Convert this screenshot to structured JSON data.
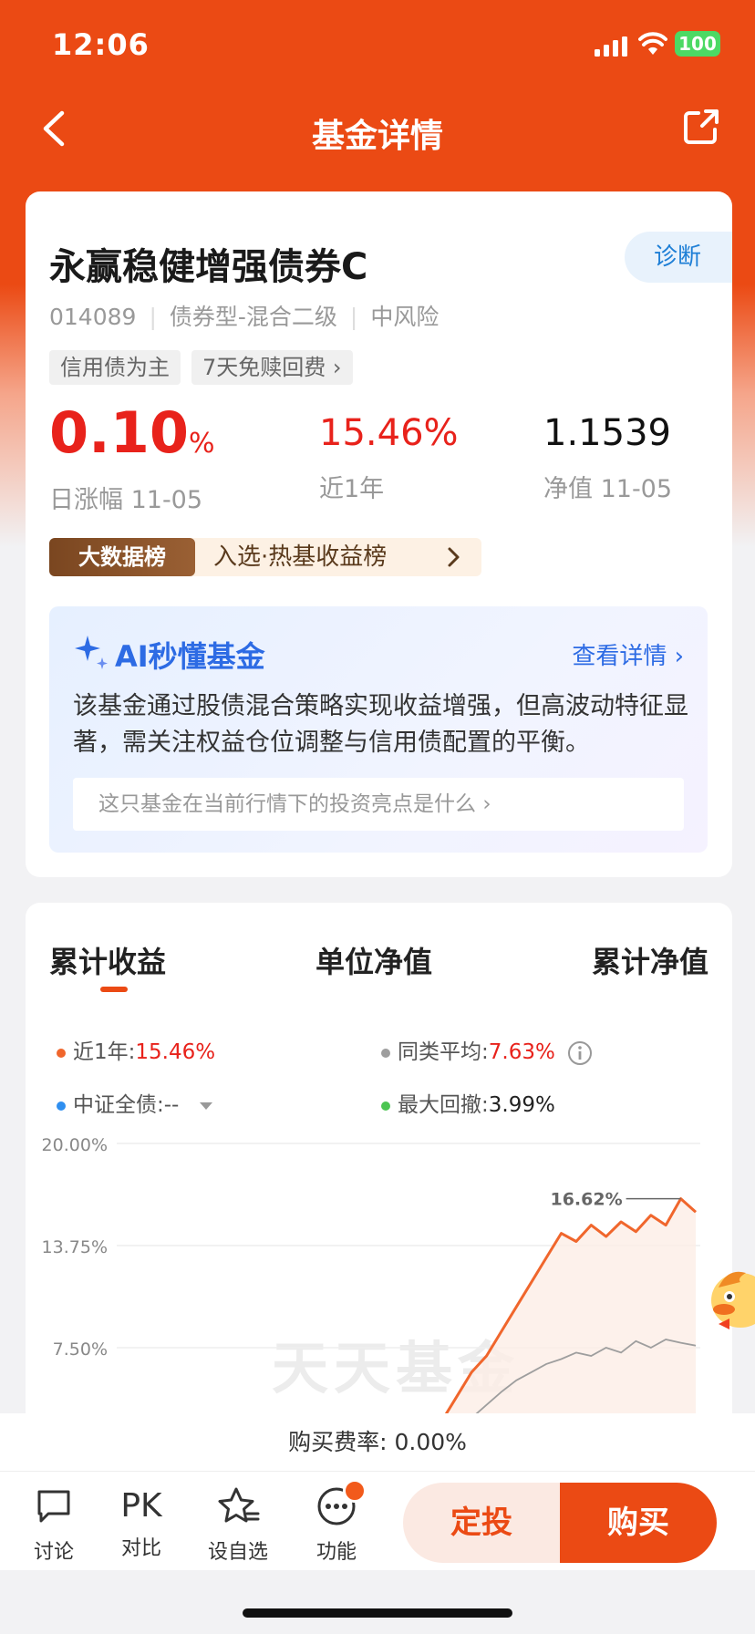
{
  "status": {
    "time": "12:06",
    "battery": "100"
  },
  "nav": {
    "title": "基金详情"
  },
  "fund": {
    "name": "永赢稳健增强债券C",
    "diagnose": "诊断",
    "code": "014089",
    "type": "债券型-混合二级",
    "risk": "中风险",
    "tags": [
      "信用债为主",
      "7天免赎回费"
    ],
    "daily_change": {
      "value": "0.10",
      "unit": "%",
      "label": "日涨幅 11-05"
    },
    "year_return": {
      "value": "15.46%",
      "label": "近1年"
    },
    "nav_value": {
      "value": "1.1539",
      "label": "净值 11-05"
    },
    "rank_badge": "大数据榜",
    "rank_text": "入选·热基收益榜"
  },
  "ai": {
    "title": "AI秒懂基金",
    "more": "查看详情",
    "text": "该基金通过股债混合策略实现收益增强，但高波动特征显著，需关注权益仓位调整与信用债配置的平衡。",
    "question": "这只基金在当前行情下的投资亮点是什么"
  },
  "chart_tabs": [
    "累计收益",
    "单位净值",
    "累计净值"
  ],
  "legend": {
    "near_year": {
      "label": "近1年:",
      "value": "15.46%"
    },
    "peer_avg": {
      "label": "同类平均:",
      "value": "7.63%"
    },
    "index": {
      "label": "中证全债:",
      "value": "--"
    },
    "max_drawdown": {
      "label": "最大回撤:",
      "value": "3.99%"
    }
  },
  "colors": {
    "brand": "#eb4a14",
    "red": "#e8221b",
    "blue": "#2d6be4",
    "fund_line": "#f0662c",
    "peer_line": "#9e9e9e",
    "drawdown": "#4cc552"
  },
  "chart_data": {
    "type": "line",
    "ylim": [
      1.25,
      20.0
    ],
    "yticks": [
      "20.00%",
      "13.75%",
      "7.50%"
    ],
    "peak_label": "16.62%",
    "series": [
      {
        "name": "近1年",
        "values": [
          1.5,
          3.0,
          4.5,
          6.0,
          7.0,
          8.5,
          10.0,
          11.5,
          13.0,
          14.5,
          14.0,
          15.0,
          14.3,
          15.2,
          14.6,
          15.6,
          15.0,
          16.62,
          15.8
        ]
      },
      {
        "name": "同类平均",
        "values": [
          1.5,
          2.0,
          2.6,
          3.2,
          4.0,
          4.8,
          5.5,
          6.0,
          6.5,
          6.8,
          7.2,
          7.0,
          7.5,
          7.2,
          7.9,
          7.5,
          8.0,
          7.8,
          7.63
        ]
      }
    ]
  },
  "watermark": "天天基金",
  "fee": "购买费率: 0.00%",
  "bottom": {
    "discuss": "讨论",
    "compare_icon": "PK",
    "compare": "对比",
    "watchlist": "设自选",
    "functions": "功能",
    "auto_invest": "定投",
    "buy": "购买"
  }
}
